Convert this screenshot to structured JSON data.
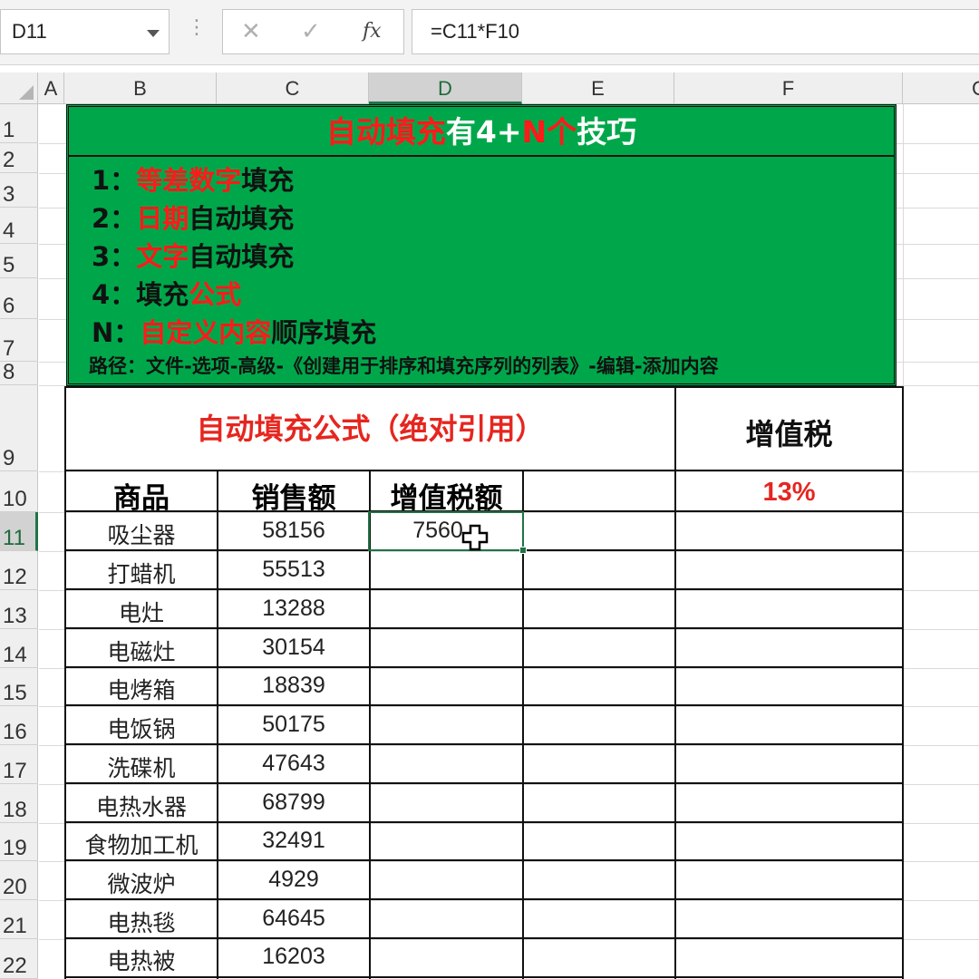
{
  "formula_bar": {
    "name_box": "D11",
    "cancel_icon": "✕",
    "enter_icon": "✓",
    "fx_label": "fx",
    "formula": "=C11*F10"
  },
  "columns": [
    "A",
    "B",
    "C",
    "D",
    "E",
    "F",
    "G"
  ],
  "rows": [
    "1",
    "2",
    "3",
    "4",
    "5",
    "6",
    "7",
    "8",
    "9",
    "10",
    "11",
    "12",
    "13",
    "14",
    "15",
    "16",
    "17",
    "18",
    "19",
    "20",
    "21",
    "22"
  ],
  "banner": {
    "title": {
      "part1": "自动填充",
      "part2": "有4+",
      "part3": "N个",
      "part4": "技巧"
    },
    "tips": [
      {
        "prefix": "1：",
        "highlight": "等差数字",
        "suffix": "填充"
      },
      {
        "prefix": "2：",
        "highlight": "日期",
        "suffix": "自动填充"
      },
      {
        "prefix": "3：",
        "highlight": "文字",
        "suffix": "自动填充"
      },
      {
        "prefix": "4：填充",
        "highlight": "公式",
        "suffix": ""
      },
      {
        "prefix": "N：",
        "highlight": "自定义内容",
        "suffix": "顺序填充"
      }
    ],
    "path": "路径：文件-选项-高级-《创建用于排序和填充序列的列表》-编辑-添加内容"
  },
  "table": {
    "section_title": "自动填充公式（绝对引用）",
    "tax_title": "增值税",
    "tax_rate": "13%",
    "headers": {
      "product": "商品",
      "sales": "销售额",
      "tax_amount": "增值税额"
    },
    "rows": [
      {
        "product": "吸尘器",
        "sales": "58156",
        "tax": "7560"
      },
      {
        "product": "打蜡机",
        "sales": "55513",
        "tax": ""
      },
      {
        "product": "电灶",
        "sales": "13288",
        "tax": ""
      },
      {
        "product": "电磁灶",
        "sales": "30154",
        "tax": ""
      },
      {
        "product": "电烤箱",
        "sales": "18839",
        "tax": ""
      },
      {
        "product": "电饭锅",
        "sales": "50175",
        "tax": ""
      },
      {
        "product": "洗碟机",
        "sales": "47643",
        "tax": ""
      },
      {
        "product": "电热水器",
        "sales": "68799",
        "tax": ""
      },
      {
        "product": "食物加工机",
        "sales": "32491",
        "tax": ""
      },
      {
        "product": "微波炉",
        "sales": "4929",
        "tax": ""
      },
      {
        "product": "电热毯",
        "sales": "64645",
        "tax": ""
      },
      {
        "product": "电热被",
        "sales": "16203",
        "tax": ""
      }
    ]
  },
  "colors": {
    "banner_green": "#00a74a",
    "highlight_red": "#ff1a1a",
    "selection_green": "#217346"
  }
}
